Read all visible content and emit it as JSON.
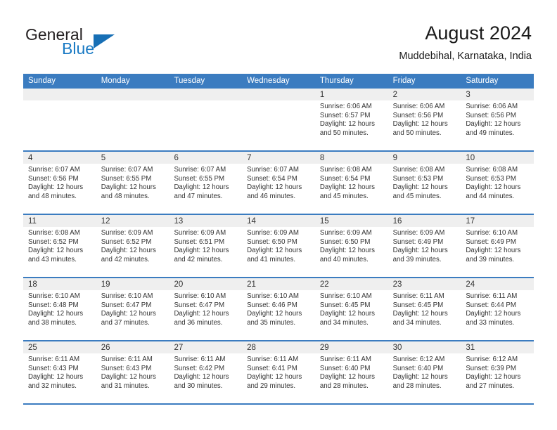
{
  "brand": {
    "name_part1": "General",
    "name_part2": "Blue",
    "logo_icon": "triangle-logo-icon"
  },
  "header": {
    "title": "August 2024",
    "subtitle": "Muddebihal, Karnataka, India"
  },
  "theme": {
    "accent": "#3b7cc0",
    "brand_blue": "#1a7ac4",
    "day_band": "#efefef",
    "text": "#333333"
  },
  "calendar": {
    "weekdays": [
      "Sunday",
      "Monday",
      "Tuesday",
      "Wednesday",
      "Thursday",
      "Friday",
      "Saturday"
    ],
    "weeks": [
      [
        {
          "day": "",
          "empty": true
        },
        {
          "day": "",
          "empty": true
        },
        {
          "day": "",
          "empty": true
        },
        {
          "day": "",
          "empty": true
        },
        {
          "day": "1",
          "sunrise": "Sunrise: 6:06 AM",
          "sunset": "Sunset: 6:57 PM",
          "daylight1": "Daylight: 12 hours",
          "daylight2": "and 50 minutes."
        },
        {
          "day": "2",
          "sunrise": "Sunrise: 6:06 AM",
          "sunset": "Sunset: 6:56 PM",
          "daylight1": "Daylight: 12 hours",
          "daylight2": "and 50 minutes."
        },
        {
          "day": "3",
          "sunrise": "Sunrise: 6:06 AM",
          "sunset": "Sunset: 6:56 PM",
          "daylight1": "Daylight: 12 hours",
          "daylight2": "and 49 minutes."
        }
      ],
      [
        {
          "day": "4",
          "sunrise": "Sunrise: 6:07 AM",
          "sunset": "Sunset: 6:56 PM",
          "daylight1": "Daylight: 12 hours",
          "daylight2": "and 48 minutes."
        },
        {
          "day": "5",
          "sunrise": "Sunrise: 6:07 AM",
          "sunset": "Sunset: 6:55 PM",
          "daylight1": "Daylight: 12 hours",
          "daylight2": "and 48 minutes."
        },
        {
          "day": "6",
          "sunrise": "Sunrise: 6:07 AM",
          "sunset": "Sunset: 6:55 PM",
          "daylight1": "Daylight: 12 hours",
          "daylight2": "and 47 minutes."
        },
        {
          "day": "7",
          "sunrise": "Sunrise: 6:07 AM",
          "sunset": "Sunset: 6:54 PM",
          "daylight1": "Daylight: 12 hours",
          "daylight2": "and 46 minutes."
        },
        {
          "day": "8",
          "sunrise": "Sunrise: 6:08 AM",
          "sunset": "Sunset: 6:54 PM",
          "daylight1": "Daylight: 12 hours",
          "daylight2": "and 45 minutes."
        },
        {
          "day": "9",
          "sunrise": "Sunrise: 6:08 AM",
          "sunset": "Sunset: 6:53 PM",
          "daylight1": "Daylight: 12 hours",
          "daylight2": "and 45 minutes."
        },
        {
          "day": "10",
          "sunrise": "Sunrise: 6:08 AM",
          "sunset": "Sunset: 6:53 PM",
          "daylight1": "Daylight: 12 hours",
          "daylight2": "and 44 minutes."
        }
      ],
      [
        {
          "day": "11",
          "sunrise": "Sunrise: 6:08 AM",
          "sunset": "Sunset: 6:52 PM",
          "daylight1": "Daylight: 12 hours",
          "daylight2": "and 43 minutes."
        },
        {
          "day": "12",
          "sunrise": "Sunrise: 6:09 AM",
          "sunset": "Sunset: 6:52 PM",
          "daylight1": "Daylight: 12 hours",
          "daylight2": "and 42 minutes."
        },
        {
          "day": "13",
          "sunrise": "Sunrise: 6:09 AM",
          "sunset": "Sunset: 6:51 PM",
          "daylight1": "Daylight: 12 hours",
          "daylight2": "and 42 minutes."
        },
        {
          "day": "14",
          "sunrise": "Sunrise: 6:09 AM",
          "sunset": "Sunset: 6:50 PM",
          "daylight1": "Daylight: 12 hours",
          "daylight2": "and 41 minutes."
        },
        {
          "day": "15",
          "sunrise": "Sunrise: 6:09 AM",
          "sunset": "Sunset: 6:50 PM",
          "daylight1": "Daylight: 12 hours",
          "daylight2": "and 40 minutes."
        },
        {
          "day": "16",
          "sunrise": "Sunrise: 6:09 AM",
          "sunset": "Sunset: 6:49 PM",
          "daylight1": "Daylight: 12 hours",
          "daylight2": "and 39 minutes."
        },
        {
          "day": "17",
          "sunrise": "Sunrise: 6:10 AM",
          "sunset": "Sunset: 6:49 PM",
          "daylight1": "Daylight: 12 hours",
          "daylight2": "and 39 minutes."
        }
      ],
      [
        {
          "day": "18",
          "sunrise": "Sunrise: 6:10 AM",
          "sunset": "Sunset: 6:48 PM",
          "daylight1": "Daylight: 12 hours",
          "daylight2": "and 38 minutes."
        },
        {
          "day": "19",
          "sunrise": "Sunrise: 6:10 AM",
          "sunset": "Sunset: 6:47 PM",
          "daylight1": "Daylight: 12 hours",
          "daylight2": "and 37 minutes."
        },
        {
          "day": "20",
          "sunrise": "Sunrise: 6:10 AM",
          "sunset": "Sunset: 6:47 PM",
          "daylight1": "Daylight: 12 hours",
          "daylight2": "and 36 minutes."
        },
        {
          "day": "21",
          "sunrise": "Sunrise: 6:10 AM",
          "sunset": "Sunset: 6:46 PM",
          "daylight1": "Daylight: 12 hours",
          "daylight2": "and 35 minutes."
        },
        {
          "day": "22",
          "sunrise": "Sunrise: 6:10 AM",
          "sunset": "Sunset: 6:45 PM",
          "daylight1": "Daylight: 12 hours",
          "daylight2": "and 34 minutes."
        },
        {
          "day": "23",
          "sunrise": "Sunrise: 6:11 AM",
          "sunset": "Sunset: 6:45 PM",
          "daylight1": "Daylight: 12 hours",
          "daylight2": "and 34 minutes."
        },
        {
          "day": "24",
          "sunrise": "Sunrise: 6:11 AM",
          "sunset": "Sunset: 6:44 PM",
          "daylight1": "Daylight: 12 hours",
          "daylight2": "and 33 minutes."
        }
      ],
      [
        {
          "day": "25",
          "sunrise": "Sunrise: 6:11 AM",
          "sunset": "Sunset: 6:43 PM",
          "daylight1": "Daylight: 12 hours",
          "daylight2": "and 32 minutes."
        },
        {
          "day": "26",
          "sunrise": "Sunrise: 6:11 AM",
          "sunset": "Sunset: 6:43 PM",
          "daylight1": "Daylight: 12 hours",
          "daylight2": "and 31 minutes."
        },
        {
          "day": "27",
          "sunrise": "Sunrise: 6:11 AM",
          "sunset": "Sunset: 6:42 PM",
          "daylight1": "Daylight: 12 hours",
          "daylight2": "and 30 minutes."
        },
        {
          "day": "28",
          "sunrise": "Sunrise: 6:11 AM",
          "sunset": "Sunset: 6:41 PM",
          "daylight1": "Daylight: 12 hours",
          "daylight2": "and 29 minutes."
        },
        {
          "day": "29",
          "sunrise": "Sunrise: 6:11 AM",
          "sunset": "Sunset: 6:40 PM",
          "daylight1": "Daylight: 12 hours",
          "daylight2": "and 28 minutes."
        },
        {
          "day": "30",
          "sunrise": "Sunrise: 6:12 AM",
          "sunset": "Sunset: 6:40 PM",
          "daylight1": "Daylight: 12 hours",
          "daylight2": "and 28 minutes."
        },
        {
          "day": "31",
          "sunrise": "Sunrise: 6:12 AM",
          "sunset": "Sunset: 6:39 PM",
          "daylight1": "Daylight: 12 hours",
          "daylight2": "and 27 minutes."
        }
      ]
    ]
  }
}
